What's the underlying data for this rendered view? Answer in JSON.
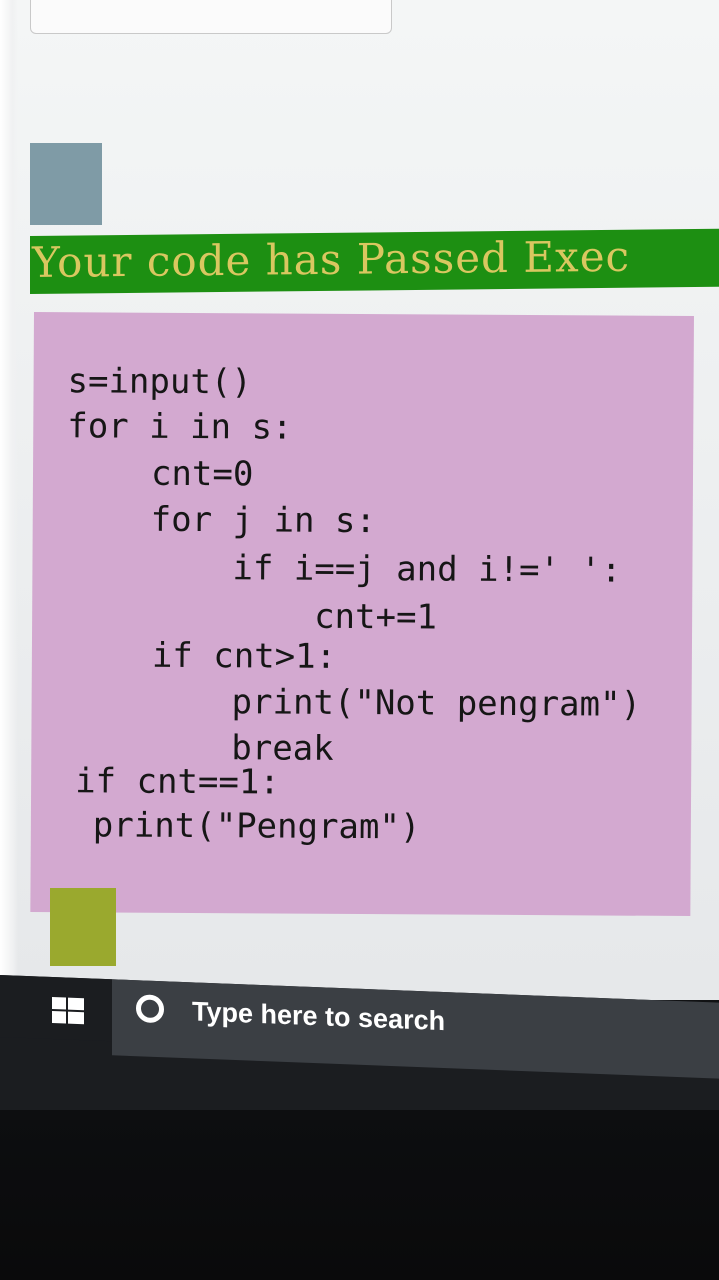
{
  "status": {
    "message": "Your code has Passed Exec",
    "bar_color": "#1d8f12",
    "text_color": "#d9c760"
  },
  "code": {
    "panel_color": "#d3a9d0",
    "lines": [
      "s=input()",
      "for i in s:",
      "cnt=0",
      "for j in s:",
      "if i==j and i!=' ':",
      "cnt+=1",
      "if cnt>1:",
      "print(\"Not pengram\")",
      "break",
      "if cnt==1:",
      "print(\"Pengram\")"
    ]
  },
  "taskbar": {
    "start_icon": "windows-logo-icon",
    "search_icon": "cortana-ring-icon",
    "search_placeholder": "Type here to search"
  },
  "colors": {
    "square_gray": "#7f9ba6",
    "square_olive": "#9aa92e"
  }
}
